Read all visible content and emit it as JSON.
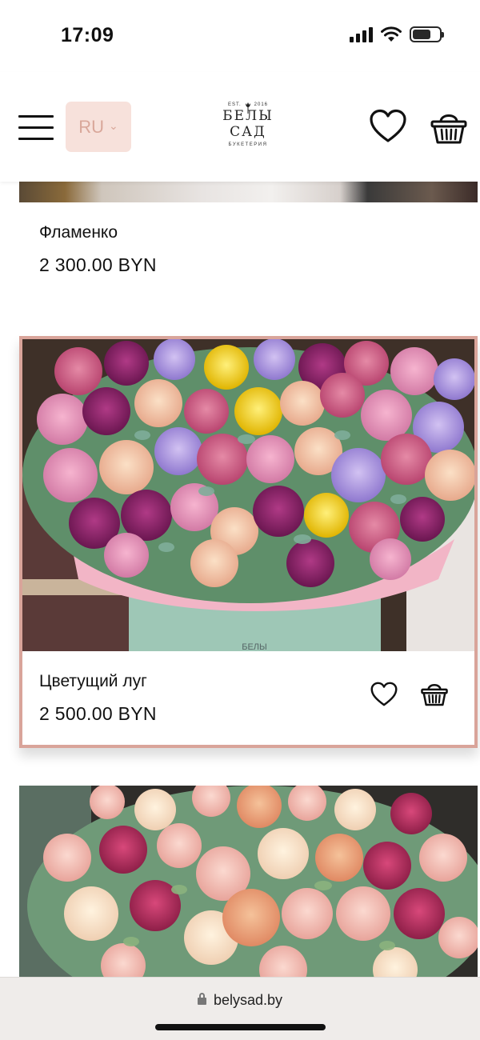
{
  "status": {
    "time": "17:09"
  },
  "header": {
    "language": "RU",
    "logo": {
      "est": "EST.",
      "year": "2016",
      "name": "БЕЛЫ САД",
      "sub": "БУКЕТЕРИЯ"
    },
    "icons": [
      "menu-icon",
      "heart-icon",
      "basket-icon"
    ]
  },
  "products": [
    {
      "name": "Фламенко",
      "price": "2 300.00 BYN"
    },
    {
      "name": "Цветущий луг",
      "price": "2 500.00 BYN"
    }
  ],
  "browser": {
    "url": "belysad.by"
  },
  "colors": {
    "accent": "#d9a49a",
    "lang_bg": "#f7e1db",
    "lang_text": "#d9a79a"
  }
}
